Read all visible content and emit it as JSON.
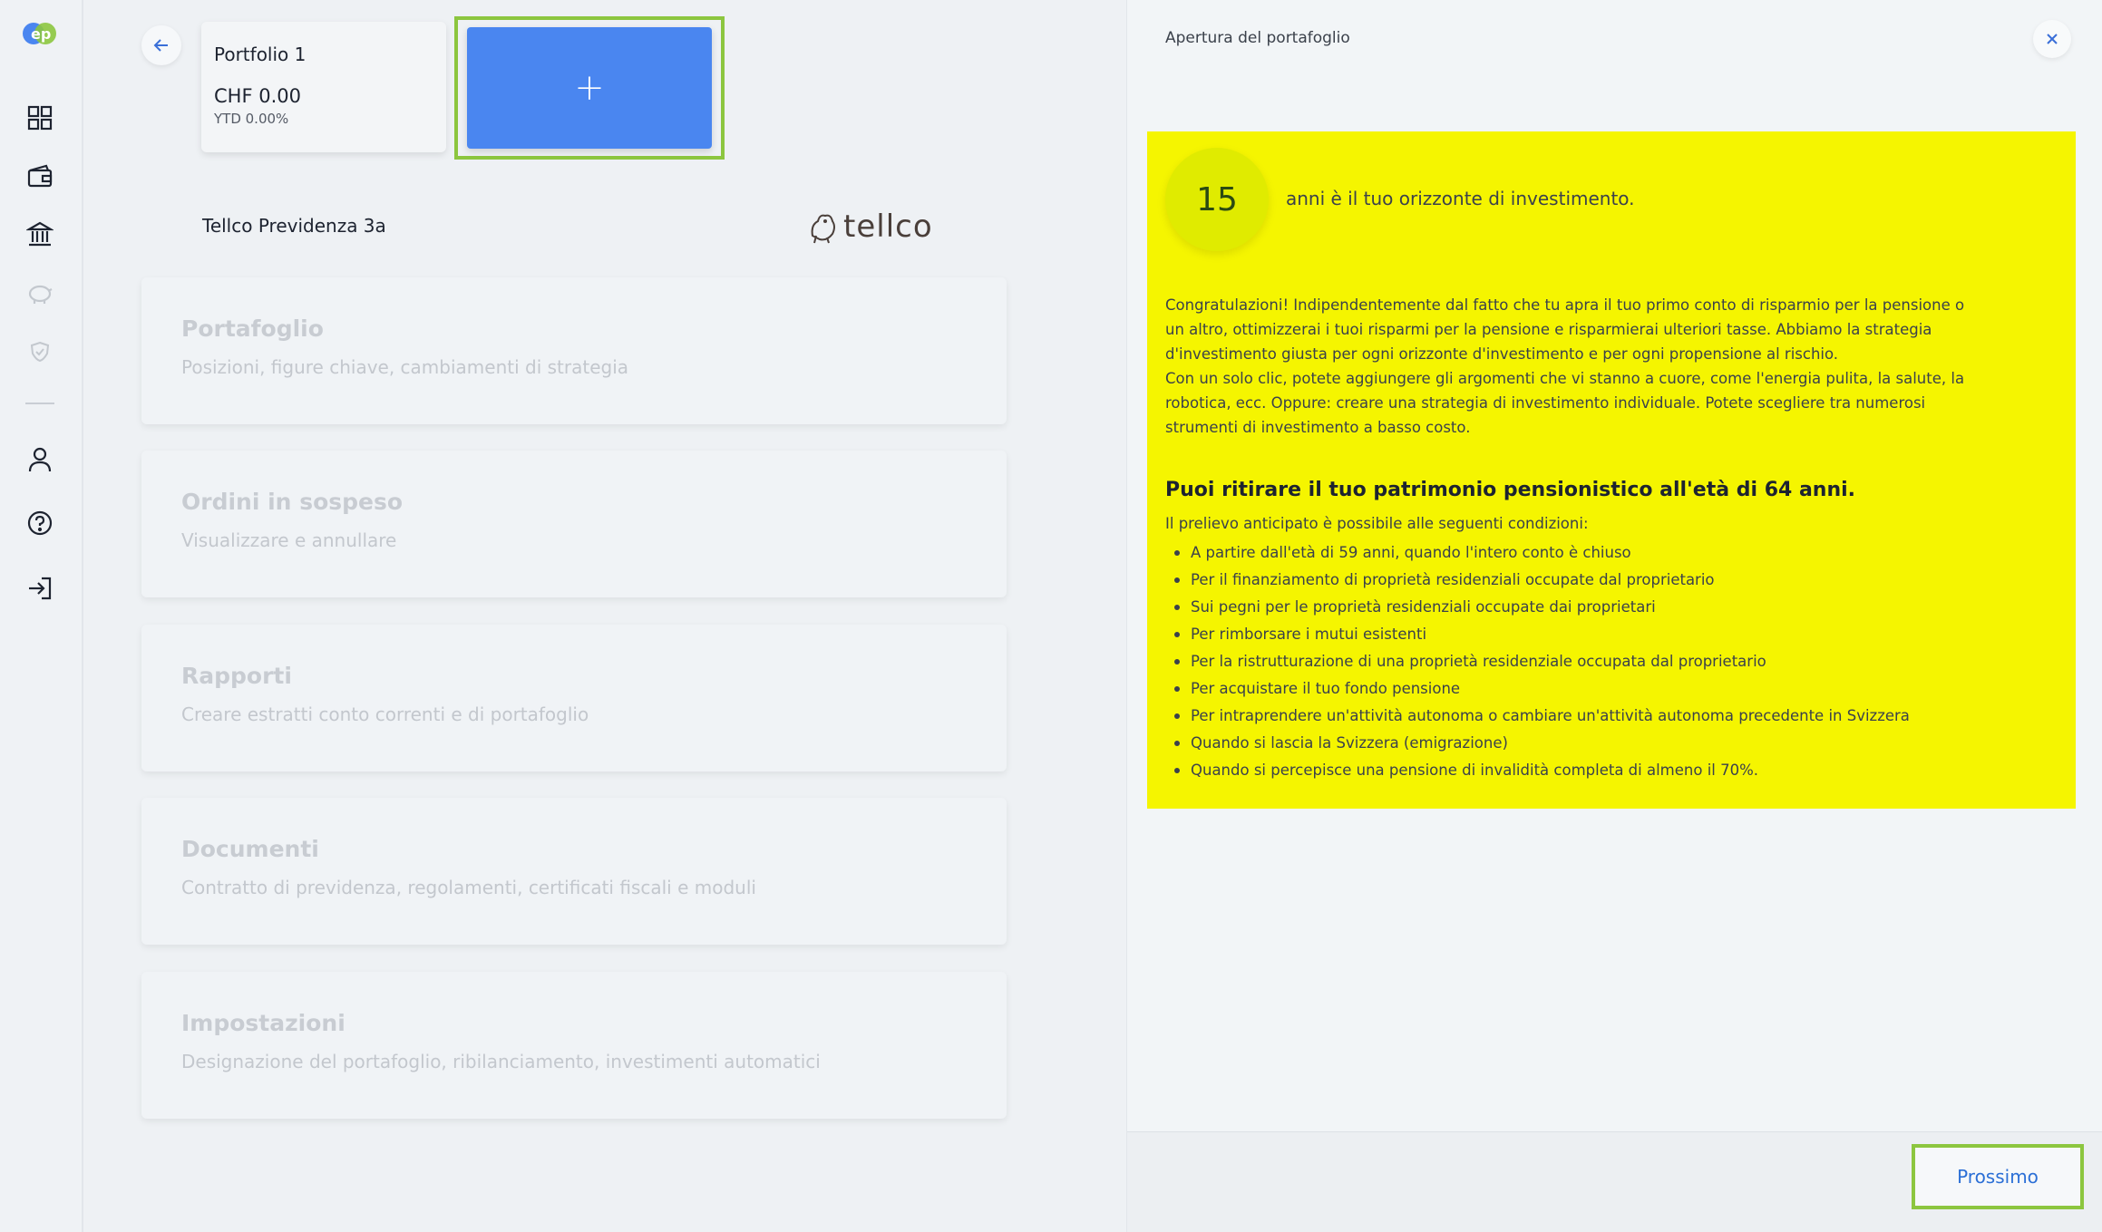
{
  "sidebar": {
    "logo_text": "ep",
    "icons": [
      "dashboard-icon",
      "wallet-icon",
      "bank-icon",
      "piggy-bank-icon",
      "shield-icon",
      "user-icon",
      "help-icon",
      "logout-icon"
    ]
  },
  "portfolio": {
    "name": "Portfolio 1",
    "amount": "CHF 0.00",
    "ytd": "YTD 0.00%",
    "add_label": "+"
  },
  "product": {
    "name": "Tellco Previdenza 3a",
    "logo_text": "tellco"
  },
  "menu": [
    {
      "title": "Portafoglio",
      "subtitle": "Posizioni, figure chiave, cambiamenti di strategia"
    },
    {
      "title": "Ordini in sospeso",
      "subtitle": "Visualizzare e annullare"
    },
    {
      "title": "Rapporti",
      "subtitle": "Creare estratti conto correnti e di portafoglio"
    },
    {
      "title": "Documenti",
      "subtitle": "Contratto di previdenza, regolamenti, certificati fiscali e moduli"
    },
    {
      "title": "Impostazioni",
      "subtitle": "Designazione del portafoglio, ribilanciamento, investimenti automatici"
    }
  ],
  "panel": {
    "title": "Apertura del portafoglio",
    "years": "15",
    "years_text": "anni è il tuo orizzonte di investimento.",
    "intro_lines": [
      "Congratulazioni! Indipendentemente dal fatto che tu apra il tuo primo conto di risparmio per la pensione o",
      "un altro, ottimizzerai i tuoi risparmi per la pensione e risparmierai ulteriori tasse. Abbiamo la strategia",
      "d'investimento giusta per ogni orizzonte d'investimento e per ogni propensione al rischio.",
      "Con un solo clic, potete aggiungere gli argomenti che vi stanno a cuore, come l'energia pulita, la salute, la",
      "robotica, ecc. Oppure: creare una strategia di investimento individuale. Potete scegliere tra numerosi",
      "strumenti di investimento a basso costo."
    ],
    "withdraw_title": "Puoi ritirare il tuo patrimonio pensionistico all'età di 64 anni.",
    "conditions_intro": "Il prelievo anticipato è possibile alle seguenti condizioni:",
    "conditions": [
      "A partire dall'età di 59 anni, quando l'intero conto è chiuso",
      "Per il finanziamento di proprietà residenziali occupate dal proprietario",
      "Sui pegni per le proprietà residenziali occupate dai proprietari",
      "Per rimborsare i mutui esistenti",
      "Per la ristrutturazione di una proprietà residenziale occupata dal proprietario",
      "Per acquistare il tuo fondo pensione",
      "Per intraprendere un'attività autonoma o cambiare un'attività autonoma precedente in Svizzera",
      "Quando si lascia la Svizzera (emigrazione)",
      "Quando si percepisce una pensione di invalidità completa di almeno il 70%."
    ],
    "next_label": "Prossimo"
  },
  "colors": {
    "accent": "#4a86f0",
    "highlight": "#f5f500",
    "focus_frame": "#8cc63f",
    "link": "#2b6fd6"
  }
}
